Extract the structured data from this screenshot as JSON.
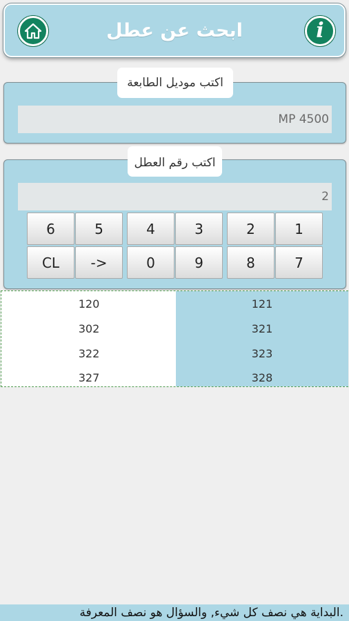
{
  "header": {
    "title": "ابحث عن عطل",
    "home_icon": "home-icon",
    "info_icon": "info-icon",
    "info_glyph": "i",
    "accent": "#13835f",
    "bar_color": "#acd7e5"
  },
  "model_panel": {
    "label": "اكتب موديل الطابعة",
    "value": "MP 4500"
  },
  "code_panel": {
    "label": "اكتب رقم العطل",
    "value": "2"
  },
  "keypad": {
    "row1": [
      "6",
      "5",
      "4",
      "3",
      "2",
      "1"
    ],
    "row2": [
      "CL",
      "->",
      "0",
      "9",
      "8",
      "7"
    ]
  },
  "results": {
    "left": [
      "120",
      "302",
      "322",
      "327"
    ],
    "right": [
      "121",
      "321",
      "323",
      "328"
    ]
  },
  "footer": {
    "text": "البداية هي نصف كل شيء, والسؤال هو نصف المعرفة."
  }
}
